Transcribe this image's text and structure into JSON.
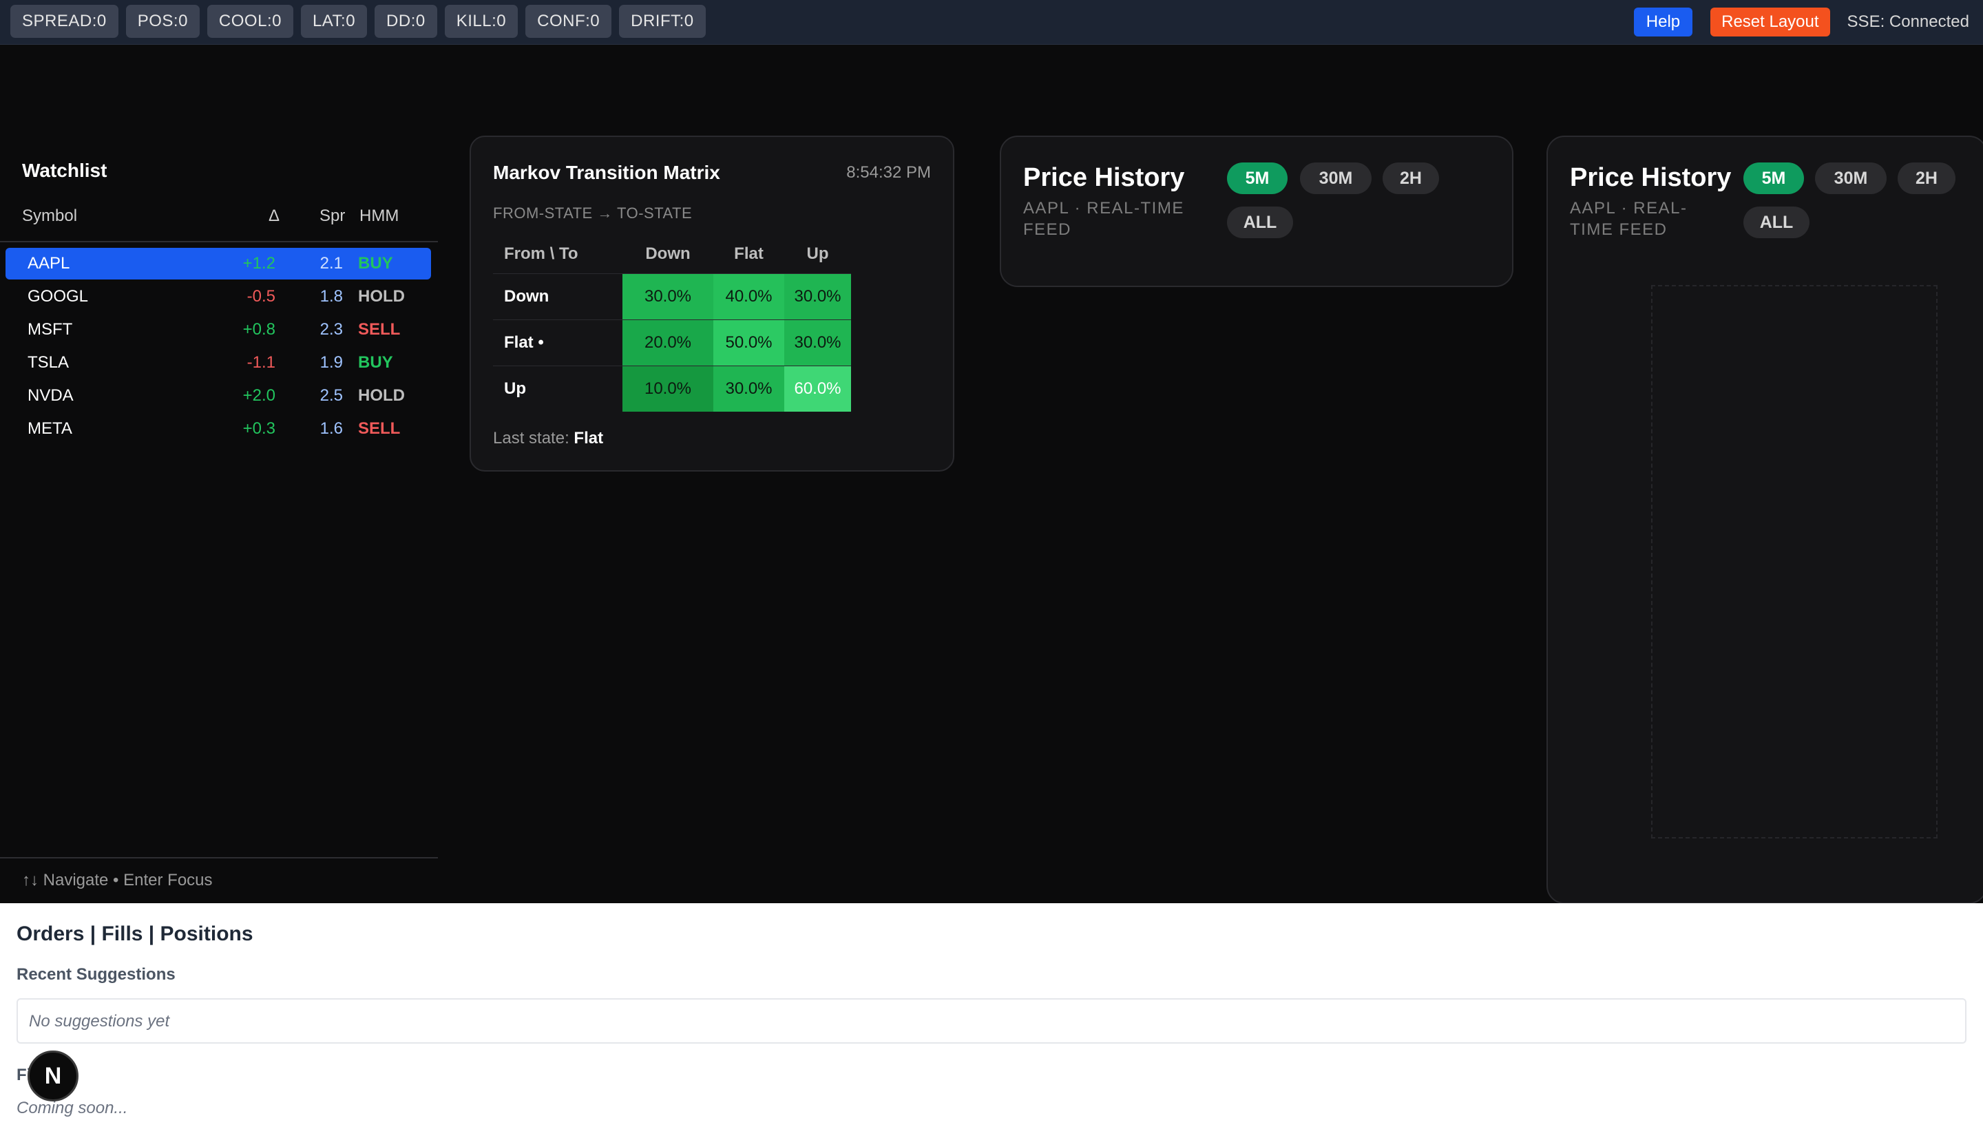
{
  "topbar": {
    "badges": [
      "SPREAD:0",
      "POS:0",
      "COOL:0",
      "LAT:0",
      "DD:0",
      "KILL:0",
      "CONF:0",
      "DRIFT:0"
    ],
    "help_label": "Help",
    "reset_label": "Reset Layout",
    "sse_status": "SSE: Connected"
  },
  "watchlist": {
    "title": "Watchlist",
    "headers": {
      "symbol": "Symbol",
      "delta": "Δ",
      "spread": "Spr",
      "hmm": "HMM"
    },
    "rows": [
      {
        "symbol": "AAPL",
        "delta": "+1.2",
        "spread": "2.1",
        "signal": "BUY",
        "selected": true
      },
      {
        "symbol": "GOOGL",
        "delta": "-0.5",
        "spread": "1.8",
        "signal": "HOLD"
      },
      {
        "symbol": "MSFT",
        "delta": "+0.8",
        "spread": "2.3",
        "signal": "SELL"
      },
      {
        "symbol": "TSLA",
        "delta": "-1.1",
        "spread": "1.9",
        "signal": "BUY"
      },
      {
        "symbol": "NVDA",
        "delta": "+2.0",
        "spread": "2.5",
        "signal": "HOLD"
      },
      {
        "symbol": "META",
        "delta": "+0.3",
        "spread": "1.6",
        "signal": "SELL"
      }
    ],
    "footer": "↑↓ Navigate • Enter Focus"
  },
  "markov": {
    "title": "Markov Transition Matrix",
    "time": "8:54:32 PM",
    "subtitle": "FROM-STATE → TO-STATE",
    "corner": "From \\ To",
    "columns": [
      "Down",
      "Flat",
      "Up"
    ],
    "rows": [
      {
        "label": "Down",
        "values": [
          "30.0%",
          "40.0%",
          "30.0%"
        ]
      },
      {
        "label": "Flat •",
        "values": [
          "20.0%",
          "50.0%",
          "30.0%"
        ]
      },
      {
        "label": "Up",
        "values": [
          "10.0%",
          "30.0%",
          "60.0%"
        ]
      }
    ],
    "last_state_label": "Last state:",
    "last_state": "Flat"
  },
  "price_history": [
    {
      "title": "Price History",
      "subtitle": "AAPL · REAL-TIME FEED",
      "ranges": [
        "5M",
        "30M",
        "2H",
        "ALL"
      ],
      "active": "5M"
    },
    {
      "title": "Price History",
      "subtitle": "AAPL · REAL-TIME FEED",
      "ranges": [
        "5M",
        "30M",
        "2H",
        "ALL"
      ],
      "active": "5M"
    }
  ],
  "bottom": {
    "title": "Orders | Fills | Positions",
    "suggestions_label": "Recent Suggestions",
    "suggestions_empty": "No suggestions yet",
    "fills_label": "Fills",
    "coming_soon": "Coming soon..."
  },
  "dev_badge": "N",
  "colors": {
    "accent_blue": "#1a5cf0",
    "reset_orange": "#f4511e",
    "positive": "#22c55e",
    "negative": "#f05a5a",
    "active_pill": "#0f9b5e"
  }
}
